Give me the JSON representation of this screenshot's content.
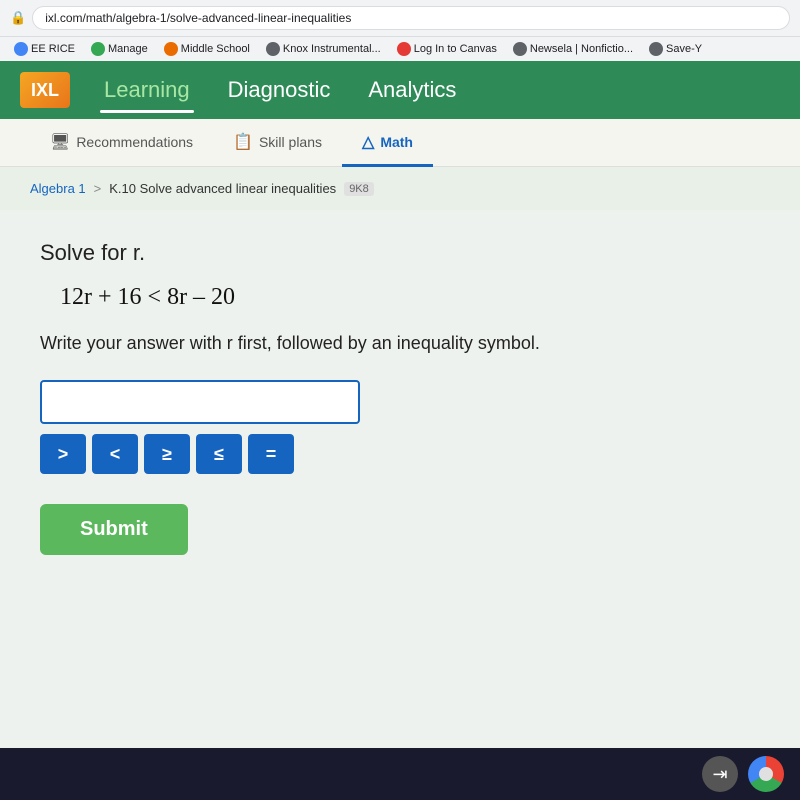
{
  "browser": {
    "url": "ixl.com/math/algebra-1/solve-advanced-linear-inequalities",
    "lock_icon": "🔒",
    "bookmarks": [
      {
        "id": "ee-rice",
        "label": "EE RICE",
        "color": "#4285f4"
      },
      {
        "id": "manage",
        "label": "Manage",
        "color": "#34a853"
      },
      {
        "id": "middle-school",
        "label": "Middle School",
        "color": "#ea6b00"
      },
      {
        "id": "knox",
        "label": "Knox Instrumental...",
        "color": "#5f6368"
      },
      {
        "id": "canvas",
        "label": "Log In to Canvas",
        "color": "#e53935"
      },
      {
        "id": "newsela",
        "label": "Newsela | Nonfictio...",
        "color": "#5f6368"
      },
      {
        "id": "save",
        "label": "Save-Y",
        "color": "#5f6368"
      }
    ]
  },
  "nav": {
    "logo_text": "IXL",
    "items": [
      {
        "id": "learning",
        "label": "Learning",
        "active": true
      },
      {
        "id": "diagnostic",
        "label": "Diagnostic",
        "active": false
      },
      {
        "id": "analytics",
        "label": "Analytics",
        "active": false
      }
    ]
  },
  "sub_nav": {
    "tabs": [
      {
        "id": "recommendations",
        "label": "Recommendations",
        "icon": "🖥",
        "active": false
      },
      {
        "id": "skill-plans",
        "label": "Skill plans",
        "icon": "📋",
        "active": false
      },
      {
        "id": "math",
        "label": "Math",
        "icon": "△",
        "active": true
      }
    ]
  },
  "breadcrumb": {
    "parent": "Algebra 1",
    "separator": ">",
    "current": "K.10 Solve advanced linear inequalities",
    "badge": "9K8"
  },
  "problem": {
    "title": "Solve for r.",
    "equation": "12r + 16 < 8r – 20",
    "instruction": "Write your answer with r first, followed by an inequality symbol.",
    "input_placeholder": "",
    "symbols": [
      ">",
      "<",
      "≥",
      "≤",
      "="
    ],
    "submit_label": "Submit"
  }
}
